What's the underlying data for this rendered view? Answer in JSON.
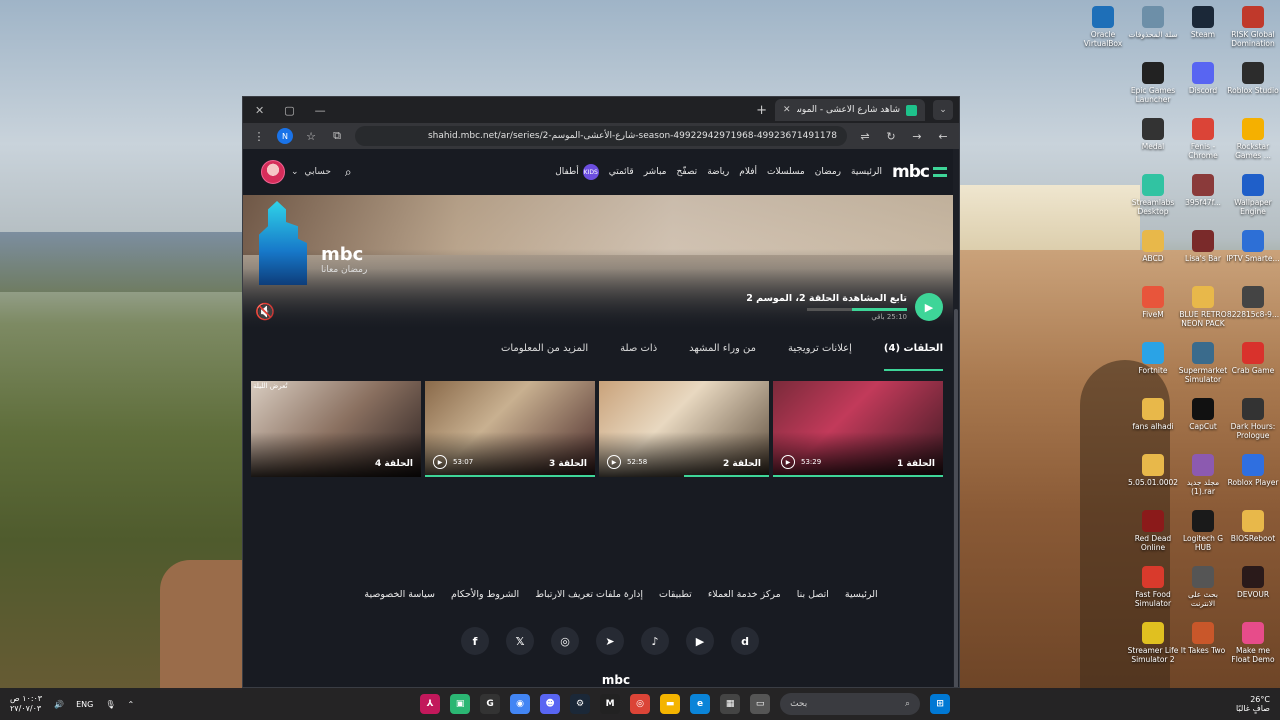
{
  "desktop": {
    "icons": [
      {
        "label": "Oracle VirtualBox",
        "icon": "virtualbox-icon",
        "color": "#1e6fb8"
      },
      {
        "label": "سلة المحذوفات",
        "icon": "recycle-bin-icon",
        "color": "#6d8fa8"
      },
      {
        "label": "Steam",
        "icon": "steam-icon",
        "color": "#1b2838"
      },
      {
        "label": "RISK Global Domination",
        "icon": "risk-icon",
        "color": "#c0392b"
      },
      {
        "label": "Epic Games Launcher",
        "icon": "epic-icon",
        "color": "#222222"
      },
      {
        "label": "Discord",
        "icon": "discord-icon",
        "color": "#5865f2"
      },
      {
        "label": "Roblox Studio",
        "icon": "roblox-studio-icon",
        "color": "#2c2c2c"
      },
      {
        "label": "Medal",
        "icon": "medal-icon",
        "color": "#333333"
      },
      {
        "label": "Fenis - Chrome",
        "icon": "chrome-icon",
        "color": "#db4437"
      },
      {
        "label": "Rockstar Games ...",
        "icon": "rockstar-icon",
        "color": "#f5b000"
      },
      {
        "label": "Streamlabs Desktop",
        "icon": "streamlabs-icon",
        "color": "#31c3a2"
      },
      {
        "label": "395f47f...",
        "icon": "image-file-icon",
        "color": "#8a3a3a"
      },
      {
        "label": "Wallpaper Engine",
        "icon": "wallpaper-engine-icon",
        "color": "#1f5fc9"
      },
      {
        "label": "ABCD",
        "icon": "folder-icon",
        "color": "#e8b84a"
      },
      {
        "label": "Lisa's Bar",
        "icon": "image-file-icon",
        "color": "#7a2a2a"
      },
      {
        "label": "IPTV Smarte...",
        "icon": "iptv-icon",
        "color": "#2d6fd6"
      },
      {
        "label": "FiveM",
        "icon": "fivem-icon",
        "color": "#e8553b"
      },
      {
        "label": "BLUE RETRO NEON PACK",
        "icon": "folder-icon",
        "color": "#e8b84a"
      },
      {
        "label": "822815c8-9...",
        "icon": "image-file-icon",
        "color": "#444444"
      },
      {
        "label": "Fortnite",
        "icon": "fortnite-icon",
        "color": "#2aa3e6"
      },
      {
        "label": "Supermarket Simulator",
        "icon": "supermarket-icon",
        "color": "#3a6b8c"
      },
      {
        "label": "Crab Game",
        "icon": "crab-game-icon",
        "color": "#d9322c"
      },
      {
        "label": "fans alhadi",
        "icon": "folder-icon",
        "color": "#e8b84a"
      },
      {
        "label": "CapCut",
        "icon": "capcut-icon",
        "color": "#111111"
      },
      {
        "label": "Dark Hours: Prologue",
        "icon": "dark-hours-icon",
        "color": "#333333"
      },
      {
        "label": "5.05.01.0002",
        "icon": "folder-icon",
        "color": "#e8b84a"
      },
      {
        "label": "مجلد جديد (1).rar",
        "icon": "archive-icon",
        "color": "#8c5ab0"
      },
      {
        "label": "Roblox Player",
        "icon": "roblox-icon",
        "color": "#2f6fe0"
      },
      {
        "label": "Red Dead Online",
        "icon": "rdo-icon",
        "color": "#8b1a1a"
      },
      {
        "label": "Logitech G HUB",
        "icon": "logitech-icon",
        "color": "#1a1a1a"
      },
      {
        "label": "BIOSReboot",
        "icon": "folder-icon",
        "color": "#e8b84a"
      },
      {
        "label": "Fast Food Simulator",
        "icon": "fast-food-icon",
        "color": "#d93a2c"
      },
      {
        "label": "بحث على الانترنت",
        "icon": "search-web-icon",
        "color": "#555555"
      },
      {
        "label": "DEVOUR",
        "icon": "devour-icon",
        "color": "#2a1a1a"
      },
      {
        "label": "Streamer Life Simulator 2",
        "icon": "streamer-life-icon",
        "color": "#e0c020"
      },
      {
        "label": "It Takes Two",
        "icon": "it-takes-two-icon",
        "color": "#c9572a"
      },
      {
        "label": "Make me Float Demo",
        "icon": "float-demo-icon",
        "color": "#e74c8a"
      }
    ]
  },
  "browser": {
    "tab_title": "شاهد شارع الأعشى - الموسم 2 | ...",
    "url": "shahid.mbc.net/ar/series/2-شارع-الأعشى-الموسم-season-49922942971968-49923671491178",
    "profile_initial": "N"
  },
  "site": {
    "logo": "mbc",
    "nav": [
      "الرئيسية",
      "رمضان",
      "مسلسلات",
      "أفلام",
      "رياضة",
      "تصفّح",
      "مباشر",
      "قائمتي",
      "أطفال"
    ],
    "kids_badge": "KIDS",
    "account_label": "حسابي",
    "hero": {
      "ramadan_logo": "mbc",
      "ramadan_sub": "رمضان معانا",
      "continue_title": "تابع المشاهدة الحلقة 2، الموسم 2",
      "remaining": "25:10 باقي",
      "progress": 0.55
    },
    "tabs": [
      "الحلقات (4)",
      "إعلانات ترويجية",
      "من وراء المشهد",
      "ذات صلة",
      "المزيد من المعلومات"
    ],
    "episodes": [
      {
        "label": "الحلقة 1",
        "duration": "53:29",
        "progress": 1.0,
        "badge": ""
      },
      {
        "label": "الحلقة 2",
        "duration": "52:58",
        "progress": 0.5,
        "badge": ""
      },
      {
        "label": "الحلقة 3",
        "duration": "53:07",
        "progress": 1.0,
        "badge": ""
      },
      {
        "label": "الحلقة 4",
        "duration": "",
        "progress": 0,
        "badge": "تُعرض الليلة"
      }
    ],
    "footer_links": [
      "الرئيسية",
      "اتصل بنا",
      "مركز خدمة العملاء",
      "تطبيقات",
      "إدارة ملفات تعريف الارتباط",
      "الشروط والأحكام",
      "سياسة الخصوصية"
    ],
    "footer_logo": "mbc"
  },
  "taskbar": {
    "weather_temp": "26°C",
    "weather_desc": "صافٍ غالبًا",
    "search_placeholder": "بحث",
    "lang": "ENG",
    "time": "١٠:٠٣ ص",
    "date": "٢٧/٠٧/٠٣"
  }
}
